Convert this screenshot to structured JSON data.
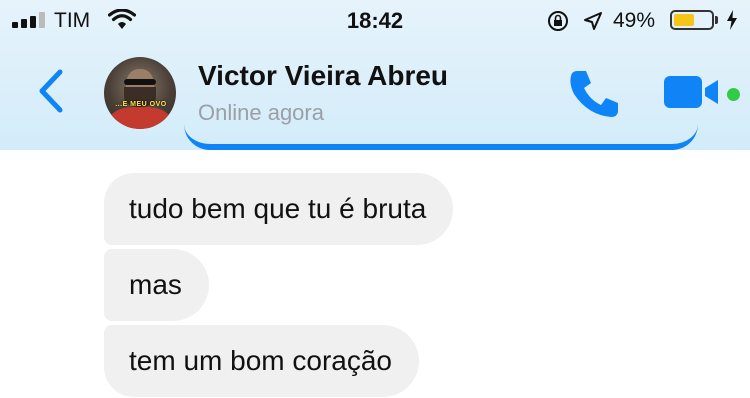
{
  "status_bar": {
    "carrier": "TIM",
    "time": "18:42",
    "battery_percent": "49%",
    "battery_level": 0.49,
    "battery_color": "#f5c518",
    "icons": [
      "signal-icon",
      "wifi-icon",
      "rotation-lock-icon",
      "location-icon",
      "battery-icon",
      "charging-bolt-icon"
    ]
  },
  "header": {
    "contact_name": "Victor Vieira Abreu",
    "presence": "Online agora",
    "icons": [
      "back-chevron-icon",
      "phone-icon",
      "video-camera-icon"
    ],
    "accent_color": "#0f84f6",
    "online_color": "#31cc46",
    "avatar_caption": "...E MEU OVO"
  },
  "messages": [
    {
      "text": "tudo bem que tu é bruta"
    },
    {
      "text": "mas"
    },
    {
      "text": "tem um bom coração"
    }
  ]
}
